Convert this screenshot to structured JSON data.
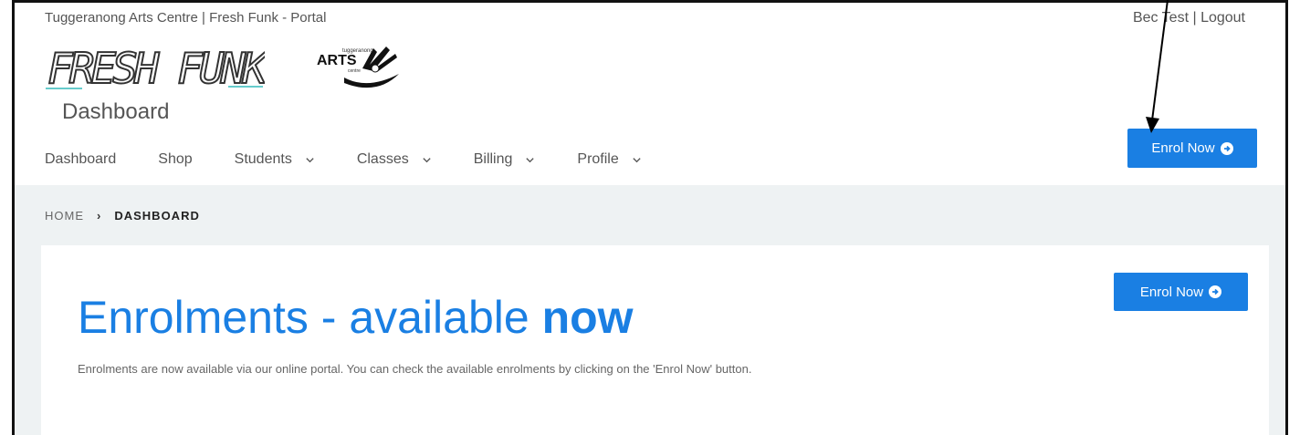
{
  "header": {
    "site_title": "Tuggeranong Arts Centre | Fresh Funk - Portal",
    "user_name": "Bec Test",
    "user_sep": " | ",
    "logout": "Logout",
    "logo_freshfunk_text": "FRESH FUNK",
    "logo_arts_small": "tuggeranong",
    "logo_arts_text": "ARTS",
    "logo_arts_sub": "centre",
    "app_title": "Dashboard",
    "enrol_button": "Enrol Now"
  },
  "nav": {
    "dashboard": "Dashboard",
    "shop": "Shop",
    "students": "Students",
    "classes": "Classes",
    "billing": "Billing",
    "profile": "Profile"
  },
  "breadcrumb": {
    "home": "HOME",
    "current": "DASHBOARD"
  },
  "card": {
    "heading_light": "Enrolments - available ",
    "heading_bold": "now",
    "text": "Enrolments are now available via our online portal. You can check the available enrolments by clicking on the 'Enrol Now' button.",
    "enrol_button": "Enrol Now"
  },
  "colors": {
    "accent": "#1a7fe3",
    "content_bg": "#eef2f3"
  }
}
